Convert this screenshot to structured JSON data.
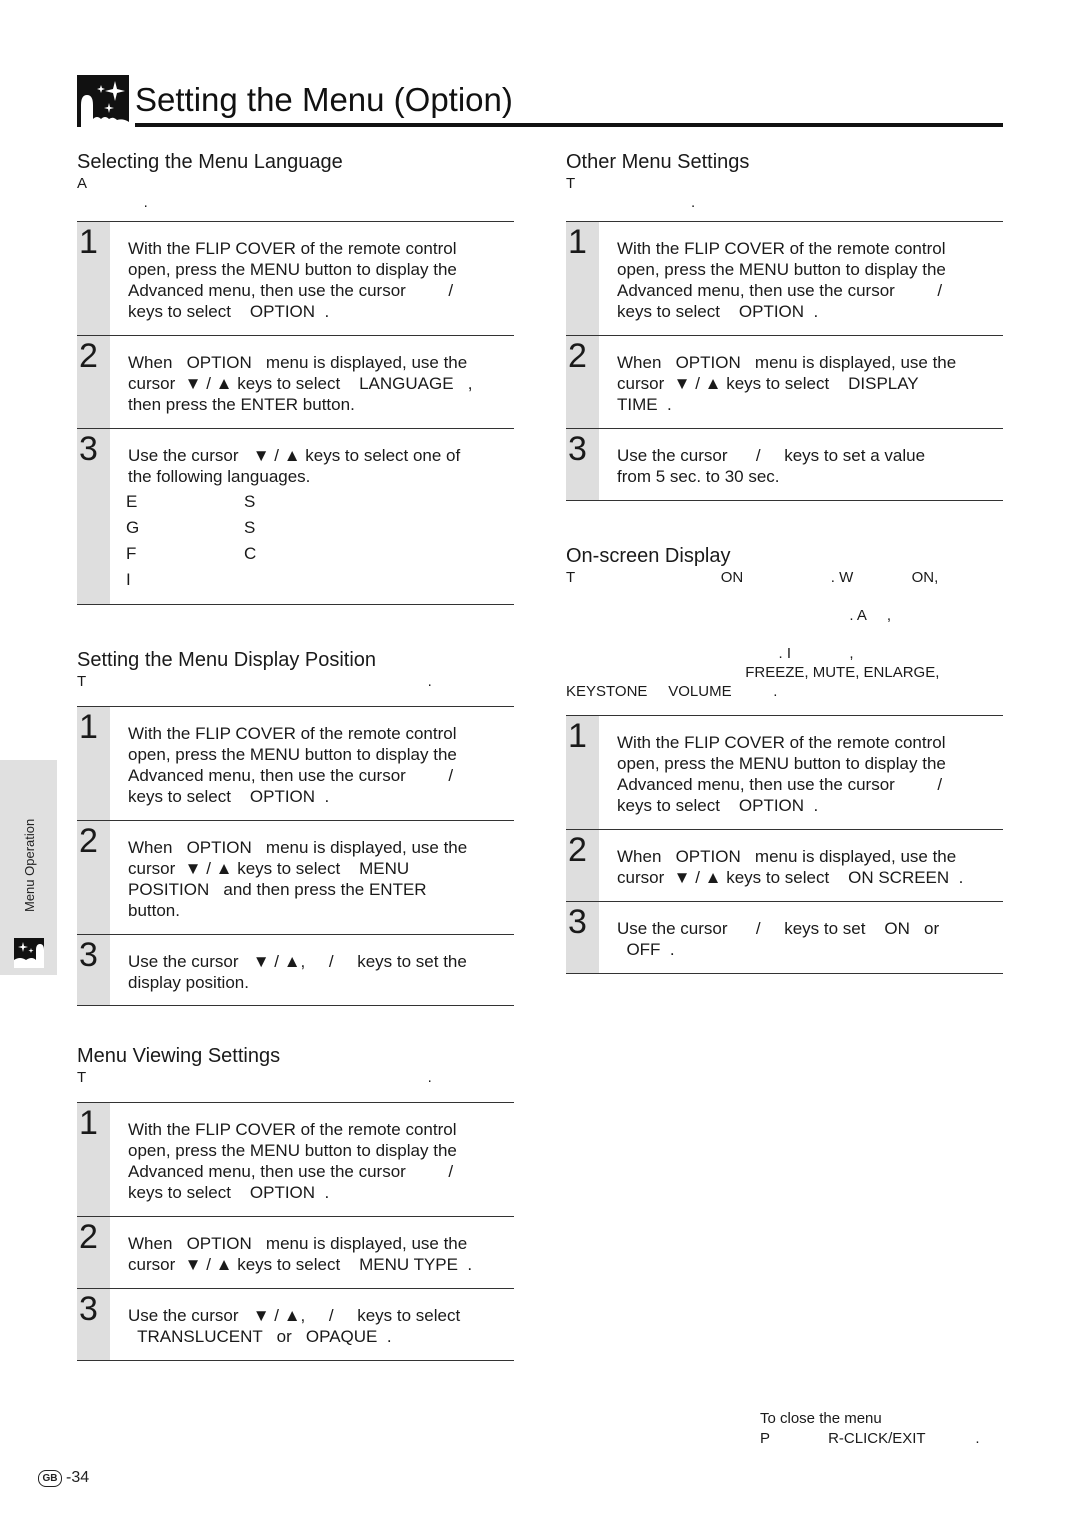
{
  "header": {
    "title": "Setting the Menu (Option)",
    "icon": "menu-sparkle-icon"
  },
  "sidebar": {
    "label": "Menu Operation",
    "icon": "menu-sparkle-icon"
  },
  "sections": {
    "language": {
      "title": "Selecting the Menu Language",
      "intro": "A\n                .",
      "steps": [
        {
          "num": "1",
          "text": "With the FLIP COVER of the remote control\nopen, press the MENU button to display the\nAdvanced menu, then use the cursor         /\nkeys to select    OPTION  ."
        },
        {
          "num": "2",
          "text": "When   OPTION   menu is displayed, use the\ncursor  ▼ / ▲ keys to select    LANGUAGE   ,\nthen press the ENTER button."
        },
        {
          "num": "3",
          "text": "Use the cursor   ▼ / ▲ keys to select one of\nthe following languages."
        }
      ],
      "languages": [
        "E",
        "S",
        "G",
        "S",
        "F",
        "C",
        "I",
        ""
      ]
    },
    "position": {
      "title": "Setting the Menu Display Position",
      "intro": "T                                                                                  .",
      "steps": [
        {
          "num": "1",
          "text": "With the FLIP COVER of the remote control\nopen, press the MENU button to display the\nAdvanced menu, then use the cursor         /\nkeys to select    OPTION  ."
        },
        {
          "num": "2",
          "text": "When   OPTION   menu is displayed, use the\ncursor  ▼ / ▲ keys to select    MENU\nPOSITION   and then press the ENTER\nbutton."
        },
        {
          "num": "3",
          "text": "Use the cursor   ▼ / ▲,     /     keys to set the\ndisplay position."
        }
      ]
    },
    "viewing": {
      "title": "Menu Viewing Settings",
      "intro": "T                                                                                  .",
      "steps": [
        {
          "num": "1",
          "text": "With the FLIP COVER of the remote control\nopen, press the MENU button to display the\nAdvanced menu, then use the cursor         /\nkeys to select    OPTION  ."
        },
        {
          "num": "2",
          "text": "When   OPTION   menu is displayed, use the\ncursor  ▼ / ▲ keys to select    MENU TYPE  ."
        },
        {
          "num": "3",
          "text": "Use the cursor   ▼ / ▲,     /     keys to select\n  TRANSLUCENT   or   OPAQUE  ."
        }
      ]
    },
    "other": {
      "title": "Other Menu Settings",
      "intro": "T\n                              .",
      "steps": [
        {
          "num": "1",
          "text": "With the FLIP COVER of the remote control\nopen, press the MENU button to display the\nAdvanced menu, then use the cursor         /\nkeys to select    OPTION  ."
        },
        {
          "num": "2",
          "text": "When   OPTION   menu is displayed, use the\ncursor  ▼ / ▲ keys to select    DISPLAY\nTIME  ."
        },
        {
          "num": "3",
          "text": "Use the cursor      /     keys to set a value\nfrom 5 sec. to 30 sec."
        }
      ]
    },
    "onscreen": {
      "title": "On-screen Display",
      "intro": "T                                   ON                     . W              ON,\n\n                                                                    . A     ,\n\n                                                   . I              ,\n                                           FREEZE, MUTE, ENLARGE,\nKEYSTONE     VOLUME          .",
      "steps": [
        {
          "num": "1",
          "text": "With the FLIP COVER of the remote control\nopen, press the MENU button to display the\nAdvanced menu, then use the cursor         /\nkeys to select    OPTION  ."
        },
        {
          "num": "2",
          "text": "When   OPTION   menu is displayed, use the\ncursor  ▼ / ▲ keys to select    ON SCREEN  ."
        },
        {
          "num": "3",
          "text": "Use the cursor      /     keys to set    ON   or\n  OFF  ."
        }
      ]
    }
  },
  "close_note": {
    "line1": "To close the menu",
    "line2": "P              R-CLICK/EXIT            ."
  },
  "footer": {
    "region_badge": "GB",
    "page_number": "-34"
  }
}
